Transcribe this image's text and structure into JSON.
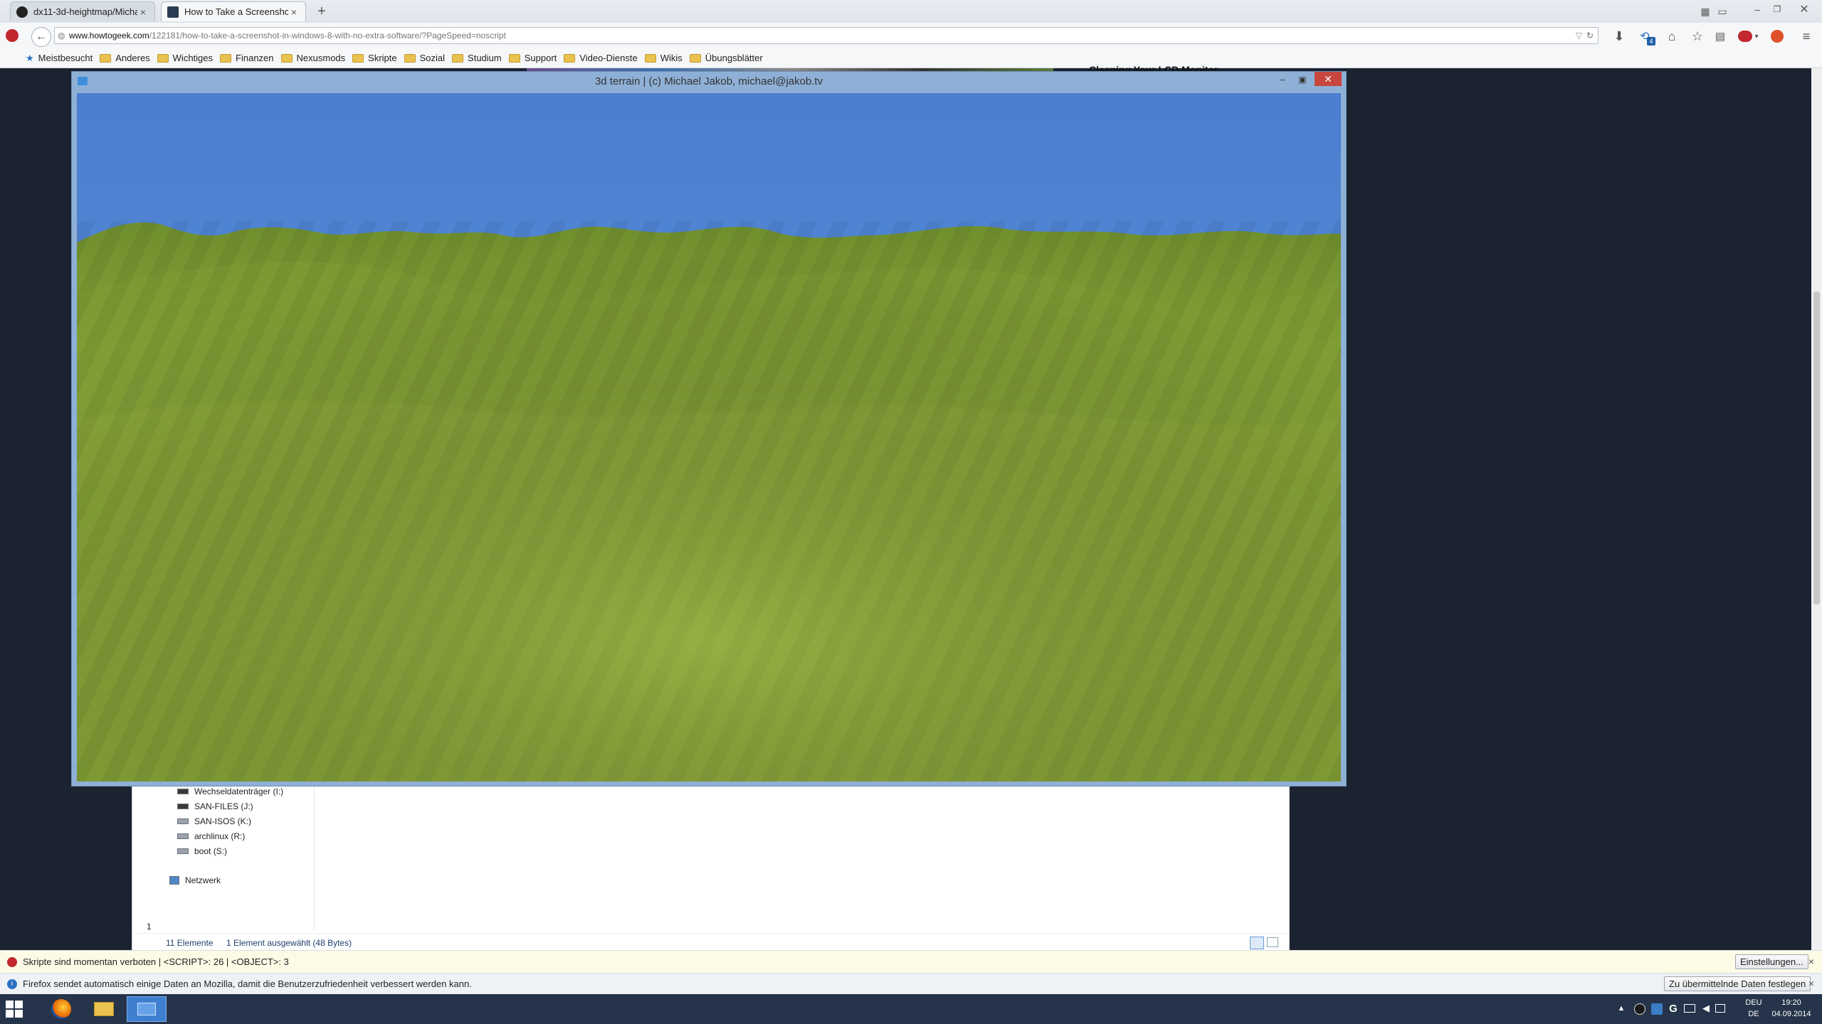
{
  "browser": {
    "tabs": [
      {
        "title": "dx11-3d-heightmap/Micha...",
        "icon": "github-icon"
      },
      {
        "title": "How to Take a Screenshot i...",
        "icon": "howtogeek-icon"
      }
    ],
    "url": {
      "domain": "www.howtogeek.com",
      "path": "/122181/how-to-take-a-screenshot-in-windows-8-with-no-extra-software/?PageSpeed=noscript"
    },
    "bookmarks": [
      "Meistbesucht",
      "Anderes",
      "Wichtiges",
      "Finanzen",
      "Nexusmods",
      "Skripte",
      "Sozial",
      "Studium",
      "Support",
      "Video-Dienste",
      "Wikis",
      "Übungsblätter"
    ],
    "page_headline_fragment": "Cleaning Your LCD Monitor",
    "download_badge": "4"
  },
  "terrain_window": {
    "title": "3d terrain | (c) Michael Jakob, michael@jakob.tv",
    "colors": {
      "sky": "#4e80d0",
      "grass_light": "#9cb843",
      "grass_dark": "#5f7a24"
    }
  },
  "explorer": {
    "drives": [
      "Wechseldatenträger (I:)",
      "SAN-FILES (J:)",
      "SAN-ISOS (K:)",
      "archlinux (R:)",
      "boot (S:)"
    ],
    "network": "Netzwerk",
    "status_count": "11 Elemente",
    "status_selected": "1 Element ausgewählt (48 Bytes)",
    "left_number": "1"
  },
  "infobars": {
    "noscript_text": "Skripte sind momentan verboten | <SCRIPT>: 26 | <OBJECT>: 3",
    "noscript_button": "Einstellungen...",
    "telemetry_text": "Firefox sendet automatisch einige Daten an Mozilla, damit die Benutzerzufriedenheit verbessert werden kann.",
    "telemetry_button": "Zu übermittelnde Daten festlegen"
  },
  "taskbar": {
    "language_top": "DEU",
    "language_bottom": "DE",
    "time": "19:20",
    "date": "04.09.2014"
  }
}
